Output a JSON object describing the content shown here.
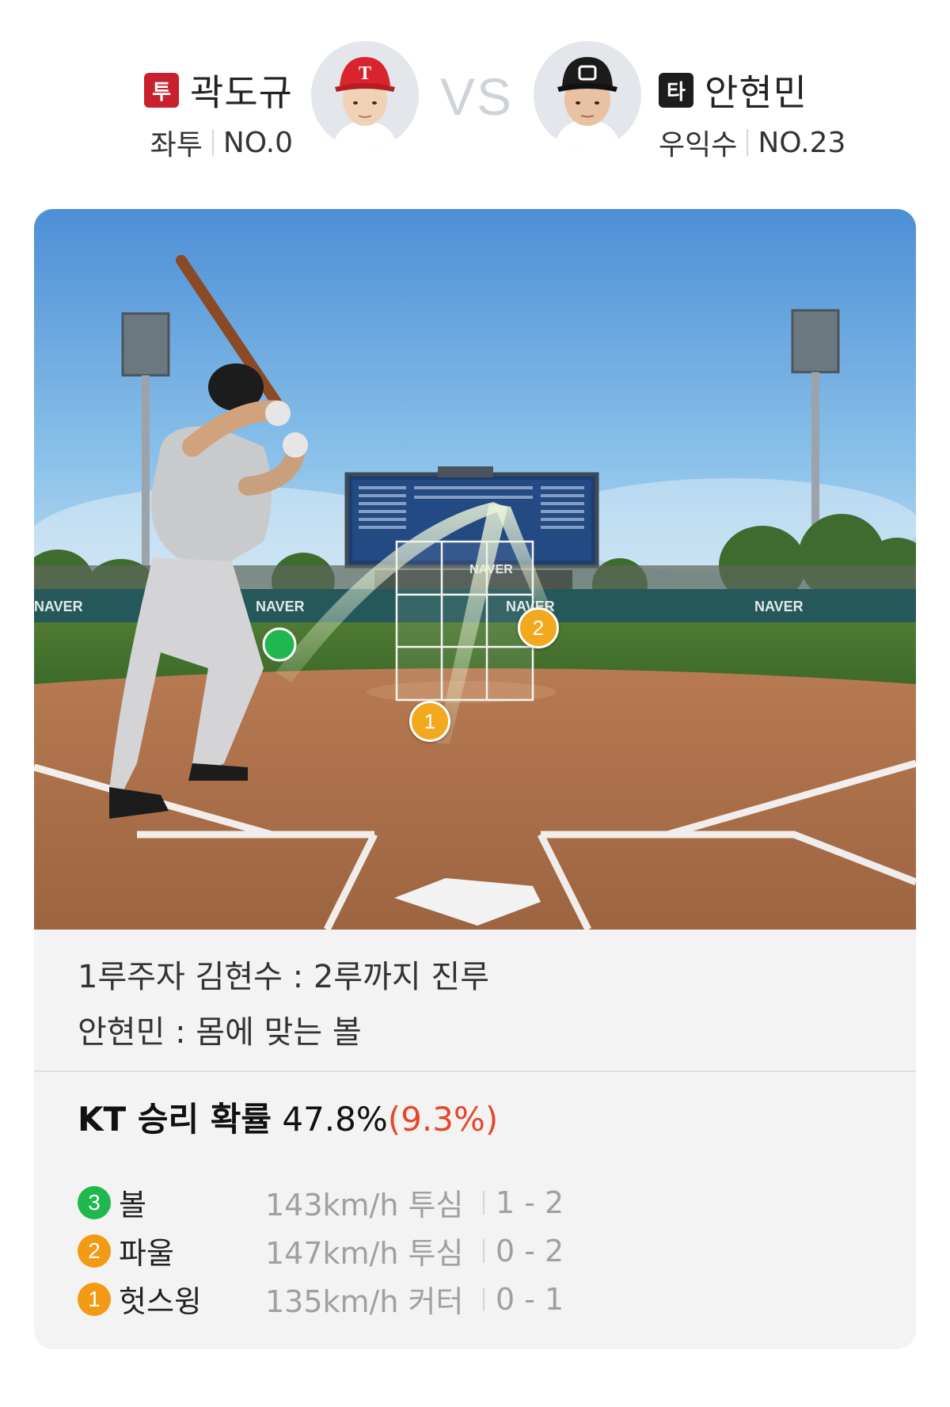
{
  "pitcher": {
    "role_badge": "투",
    "name": "곽도규",
    "hand": "좌투",
    "number": "NO.0",
    "avatar_icon": "pitcher-avatar-icon",
    "team_color": "#c8202e"
  },
  "vs_label": "VS",
  "batter": {
    "role_badge": "타",
    "name": "안현민",
    "hand": "우익수",
    "number": "NO.23",
    "avatar_icon": "batter-avatar-icon",
    "team_color": "#1d1d1d"
  },
  "field": {
    "ad_boards": [
      "NAVER",
      "NAVER",
      "NAVER",
      "NAVER",
      "NAVER"
    ],
    "markers": [
      {
        "label": "1",
        "color": "#f2a91d"
      },
      {
        "label": "2",
        "color": "#f2a91d"
      }
    ]
  },
  "events": [
    "1루주자 김현수 : 2루까지 진루",
    "안현민 : 몸에 맞는 볼"
  ],
  "win_probability": {
    "label": "KT 승리 확률",
    "value": "47.8%",
    "delta": "(9.3%)",
    "delta_color": "#e8462b"
  },
  "pitches": [
    {
      "num": "3",
      "result": "볼",
      "speed_type": "143km/h 투심",
      "count": "1 - 2",
      "color": "#1fb84e"
    },
    {
      "num": "2",
      "result": "파울",
      "speed_type": "147km/h 투심",
      "count": "0 - 2",
      "color": "#f39a14"
    },
    {
      "num": "1",
      "result": "헛스윙",
      "speed_type": "135km/h 커터",
      "count": "0 - 1",
      "color": "#f39a14"
    }
  ]
}
